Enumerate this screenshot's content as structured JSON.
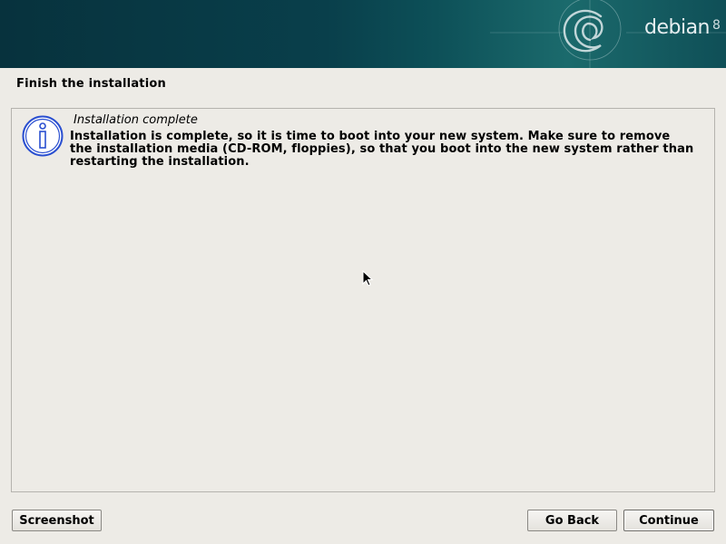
{
  "banner": {
    "brand": "debian",
    "version": "8"
  },
  "page": {
    "title": "Finish the installation"
  },
  "message": {
    "title": "Installation complete",
    "body": "Installation is complete, so it is time to boot into your new system. Make sure to remove the installation media (CD-ROM, floppies), so that you boot into the new system rather than restarting the installation."
  },
  "buttons": {
    "screenshot": "Screenshot",
    "go_back": "Go Back",
    "continue": "Continue"
  },
  "icons": {
    "message": "info-icon",
    "logo": "debian-swirl-icon",
    "pointer": "mouse-cursor-icon"
  },
  "colors": {
    "banner": "#07323d",
    "info_icon": "#2a4fd0",
    "background": "#edebe6"
  }
}
